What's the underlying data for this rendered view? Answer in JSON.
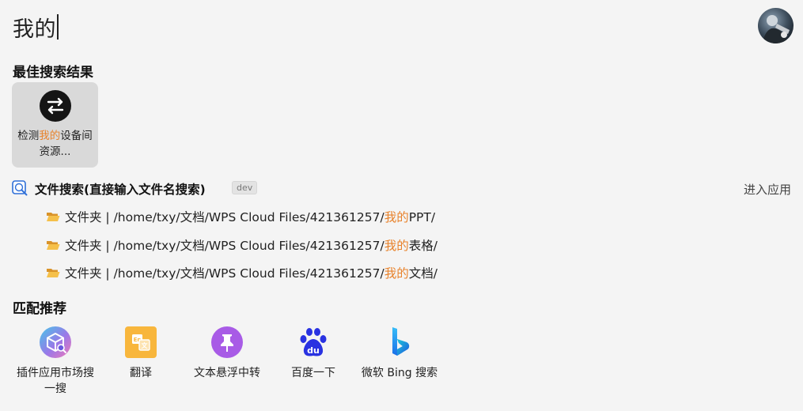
{
  "search": {
    "query": "我的"
  },
  "best_results": {
    "title": "最佳搜索结果",
    "card": {
      "label_pre": "检测",
      "label_hl": "我的",
      "label_post": "设备间资源..."
    }
  },
  "file_search": {
    "title": "文件搜索(直接输入文件名搜索)",
    "badge": "dev",
    "enter_app": "进入应用",
    "rows": [
      {
        "prefix": "文件夹 | /home/txy/文档/WPS Cloud Files/421361257/",
        "hl": "我的",
        "suffix": "PPT/"
      },
      {
        "prefix": "文件夹 | /home/txy/文档/WPS Cloud Files/421361257/",
        "hl": "我的",
        "suffix": "表格/"
      },
      {
        "prefix": "文件夹 | /home/txy/文档/WPS Cloud Files/421361257/",
        "hl": "我的",
        "suffix": "文档/"
      }
    ]
  },
  "recommend": {
    "title": "匹配推荐",
    "items": [
      {
        "label": "插件应用市场搜一搜",
        "icon": "plugin-market-icon"
      },
      {
        "label": "翻译",
        "icon": "translate-icon"
      },
      {
        "label": "文本悬浮中转",
        "icon": "pin-icon"
      },
      {
        "label": "百度一下",
        "icon": "baidu-icon"
      },
      {
        "label": "微软 Bing 搜索",
        "icon": "bing-icon"
      }
    ]
  },
  "colors": {
    "highlight": "#e8822b",
    "background": "#f4f4f4",
    "card": "#d9d9d9"
  }
}
